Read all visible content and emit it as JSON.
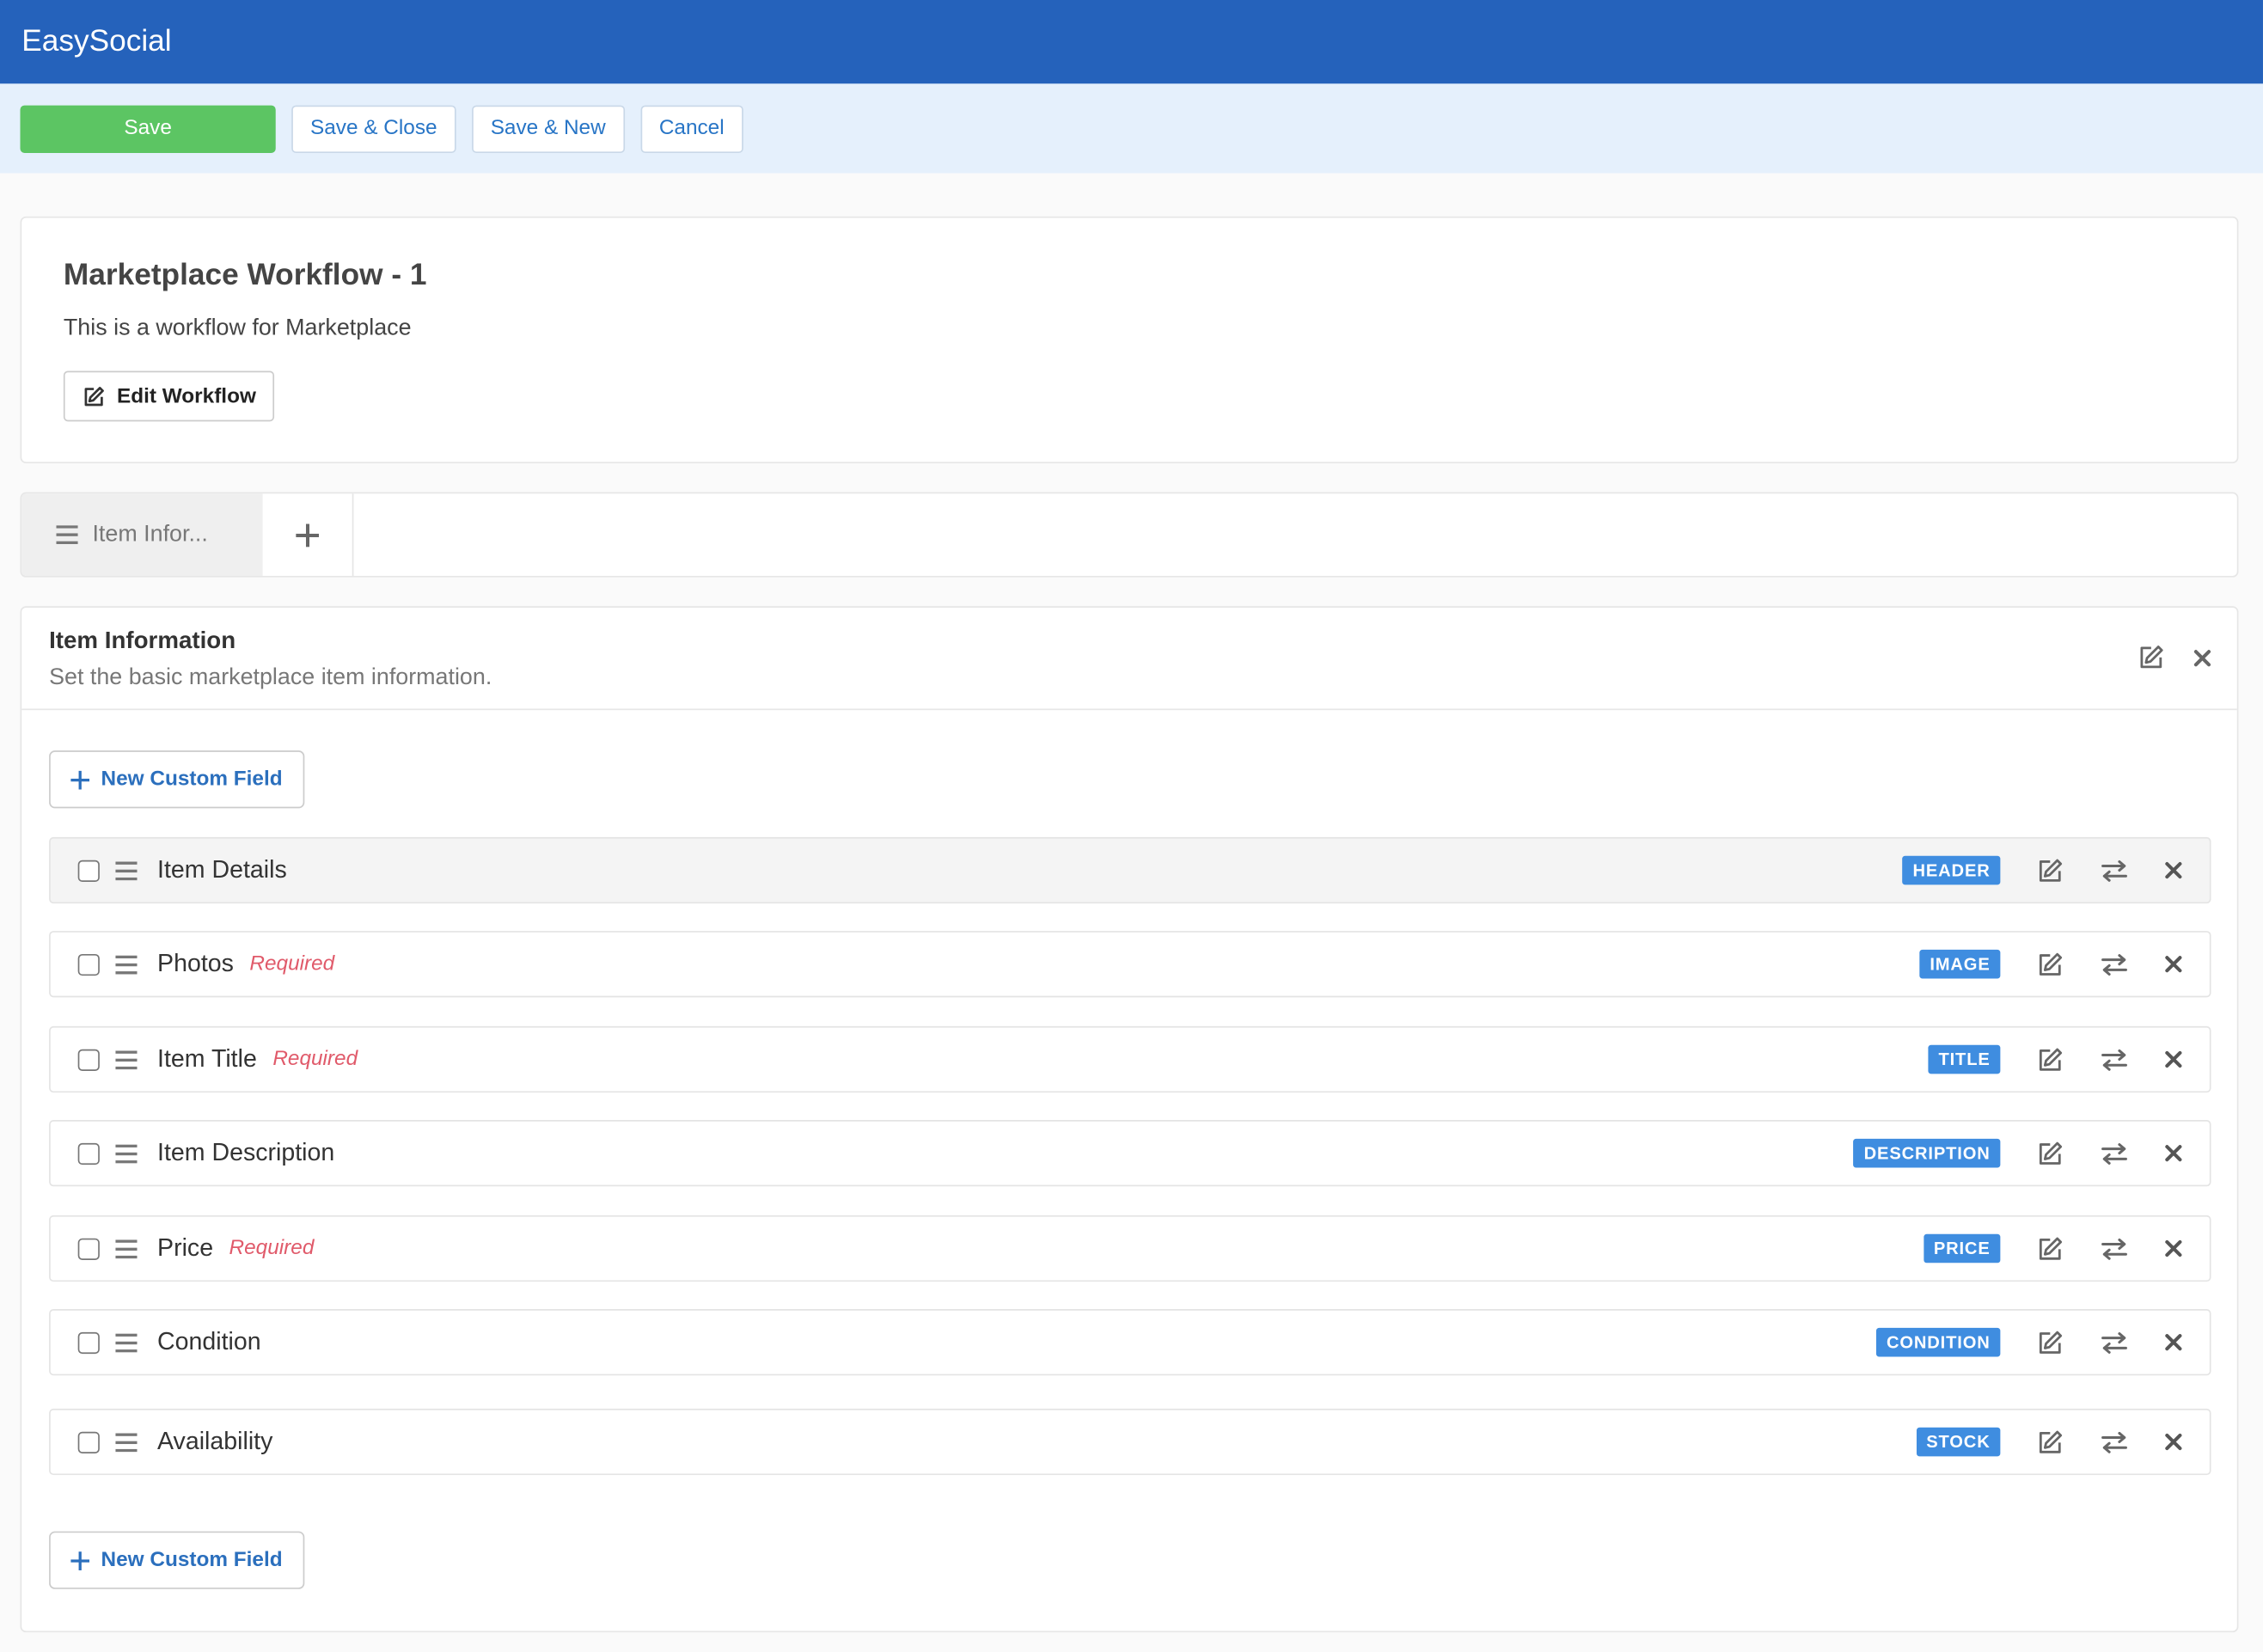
{
  "app": {
    "title": "EasySocial"
  },
  "toolbar": {
    "save": "Save",
    "save_close": "Save & Close",
    "save_new": "Save & New",
    "cancel": "Cancel"
  },
  "workflow": {
    "title": "Marketplace Workflow - 1",
    "description": "This is a workflow for Marketplace",
    "edit_label": "Edit Workflow"
  },
  "tabs": [
    {
      "label": "Item Infor..."
    }
  ],
  "section": {
    "title": "Item Information",
    "subtitle": "Set the basic marketplace item information.",
    "new_field_label": "New Custom Field",
    "fields": [
      {
        "label": "Item Details",
        "required": "",
        "badge": "HEADER"
      },
      {
        "label": "Photos",
        "required": "Required",
        "badge": "IMAGE"
      },
      {
        "label": "Item Title",
        "required": "Required",
        "badge": "TITLE"
      },
      {
        "label": "Item Description",
        "required": "",
        "badge": "DESCRIPTION"
      },
      {
        "label": "Price",
        "required": "Required",
        "badge": "PRICE"
      },
      {
        "label": "Condition",
        "required": "",
        "badge": "CONDITION"
      },
      {
        "label": "Availability",
        "required": "",
        "badge": "STOCK"
      }
    ]
  },
  "colors": {
    "topbar": "#2562bb",
    "toolbar_bg": "#e5f0fc",
    "save": "#5cc563",
    "badge": "#3f8de0",
    "required": "#e05a6a"
  },
  "icons": [
    "edit-icon",
    "close-icon",
    "bars-icon",
    "plus-icon",
    "swap-icon"
  ]
}
